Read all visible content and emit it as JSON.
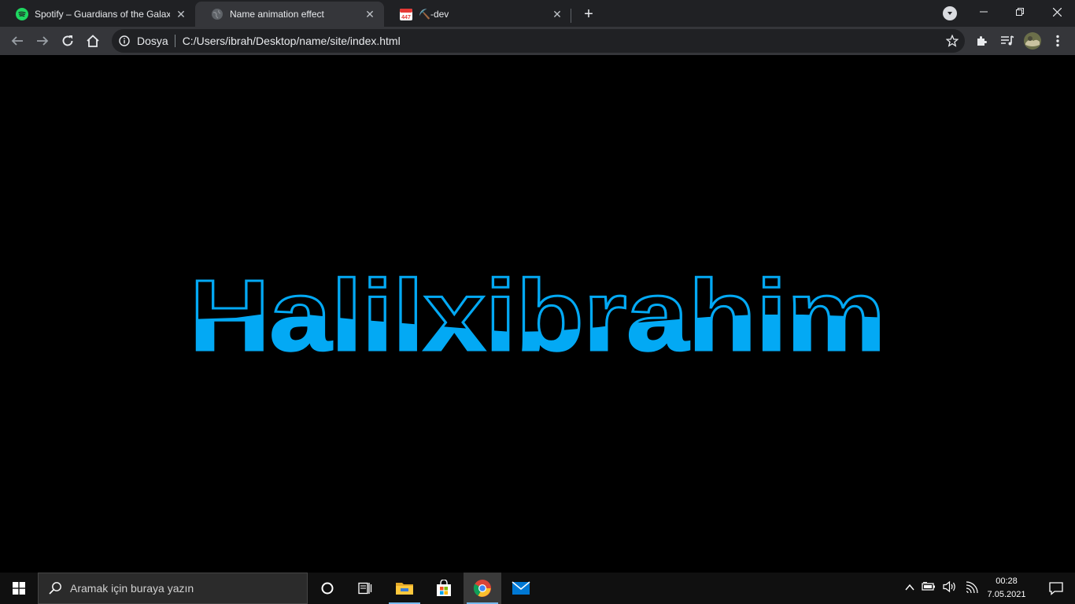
{
  "browser": {
    "tabs": [
      {
        "title": "Spotify – Guardians of the Galaxy",
        "favicon": "spotify-icon"
      },
      {
        "title": "Name animation effect",
        "favicon": "globe-icon",
        "active": true
      },
      {
        "title": "⛏️-dev",
        "favicon": "calendar-447-icon"
      }
    ],
    "calendar_badge": "447",
    "omnibox": {
      "chip": "Dosya",
      "url": "C:/Users/ibrah/Desktop/name/site/index.html"
    }
  },
  "page": {
    "name_text": "Halilxibrahim",
    "colors": {
      "accent": "#03a9f4",
      "background": "#000000"
    }
  },
  "taskbar": {
    "search_placeholder": "Aramak için buraya yazın",
    "time": "00:28",
    "date": "7.05.2021"
  }
}
